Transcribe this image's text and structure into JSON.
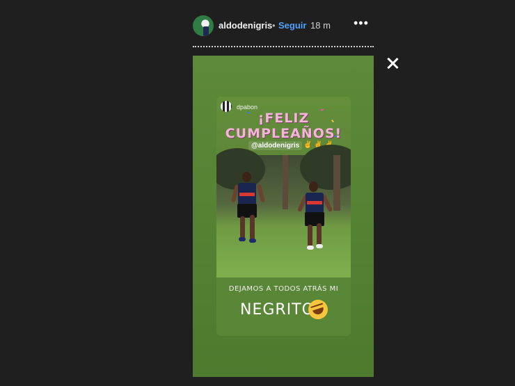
{
  "header": {
    "username": "aldodenigris",
    "separator": "•",
    "follow_label": "Seguir",
    "time_ago": "18 m",
    "more_icon": "•••"
  },
  "story": {
    "sticker_username": "dpabon",
    "greeting_line1": "¡FELIZ",
    "greeting_line2": "CUMPLEAÑOS!",
    "mention": "@aldodenigris",
    "mention_emoji": "✌ ✌ ✌",
    "caption_line1": "DEJAMOS A TODOS ATRÁS MI",
    "caption_line2": "NEGRITO"
  },
  "colors": {
    "background": "#1f1f1f",
    "story_green": "#5d8a38",
    "follow_blue": "#4da3ff",
    "greeting_pink": "#f4b5d9"
  },
  "icons": {
    "close": "close-icon",
    "more": "more-options-icon",
    "laugh": "rolling-laughing-emoji"
  }
}
